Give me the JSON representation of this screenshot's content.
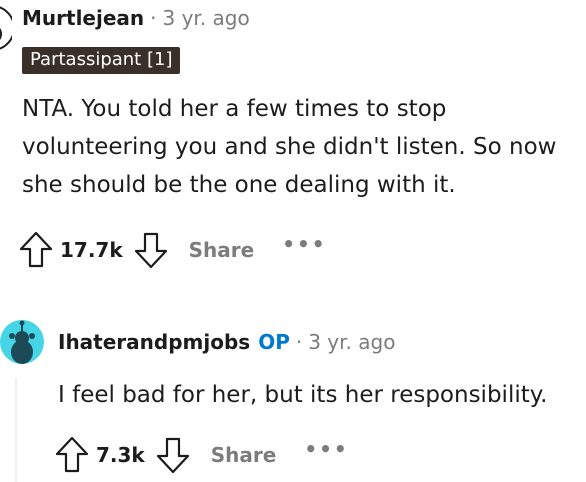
{
  "comment1": {
    "username": "Murtlejean",
    "separator": "·",
    "timestamp": "3 yr. ago",
    "flair": "Partassipant [1]",
    "body": "NTA. You told her a few times to stop volunteering you and she didn't listen. So now she should be the one dealing with it.",
    "score": "17.7k",
    "share_label": "Share",
    "more_label": "•••"
  },
  "comment2": {
    "username": "Ihaterandpmjobs",
    "op_badge": "OP",
    "separator": "·",
    "timestamp": "3 yr. ago",
    "body": "I feel bad for her, but its her responsibility.",
    "score": "7.3k",
    "share_label": "Share",
    "more_label": "•••"
  },
  "colors": {
    "flair_bg": "#3b2f2a",
    "op_badge": "#0079d3",
    "avatar_bg": "#46d5e6",
    "muted_text": "#7c7c7c"
  }
}
